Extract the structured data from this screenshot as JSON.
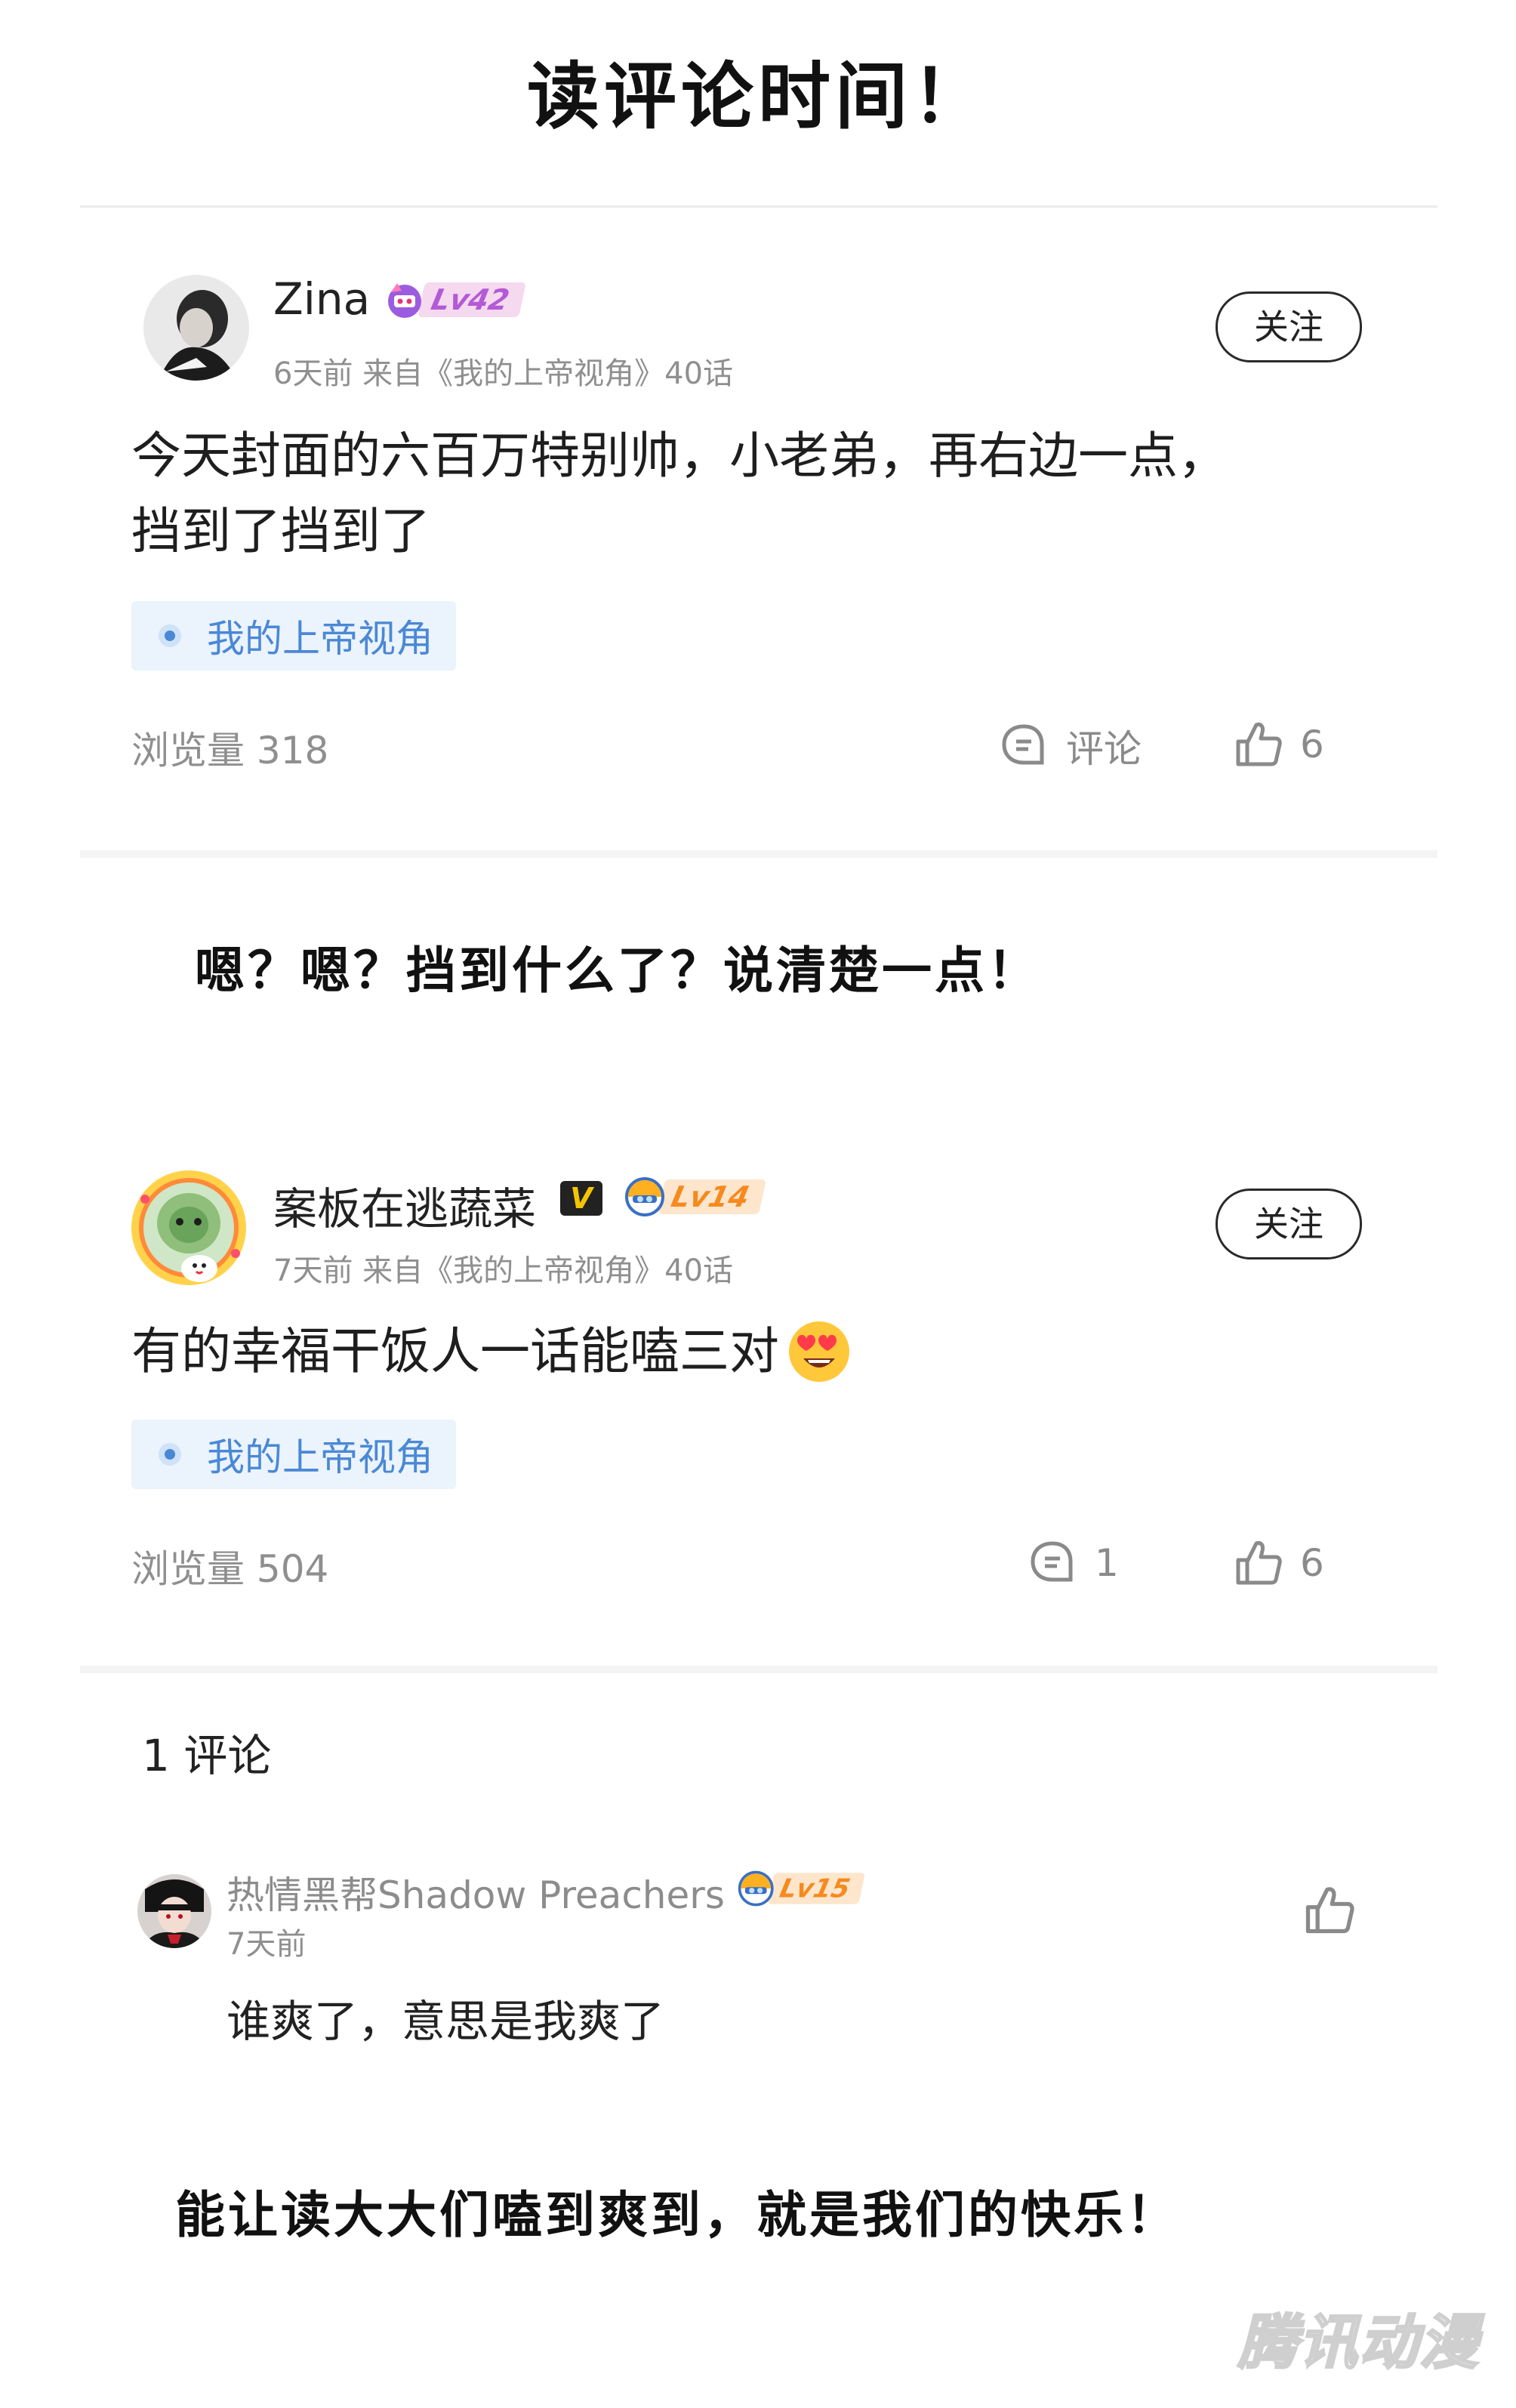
{
  "header": {
    "title": "读评论时间！"
  },
  "posts": [
    {
      "username": "Zina",
      "level": "Lv42",
      "meta": "6天前 来自《我的上帝视角》40话",
      "follow_label": "关注",
      "text_lines": [
        "今天封面的六百万特别帅，小老弟，再右边一点，",
        "挡到了挡到了"
      ],
      "topic": "我的上帝视角",
      "views": "浏览量 318",
      "comment_label": "评论",
      "likes": "6"
    },
    {
      "username": "案板在逃蔬菜",
      "vip": "V",
      "level": "Lv14",
      "meta": "7天前 来自《我的上帝视角》40话",
      "follow_label": "关注",
      "text": "有的幸福干饭人一话能嗑三对",
      "topic": "我的上帝视角",
      "views": "浏览量 504",
      "comment_count": "1",
      "likes": "6"
    }
  ],
  "captions": {
    "first": "嗯？嗯？挡到什么了？说清楚一点！",
    "last": "能让读大大们嗑到爽到，就是我们的快乐！"
  },
  "comments_section": {
    "count_label": "1 评论",
    "reply": {
      "username": "热情黑帮Shadow Preachers",
      "level": "Lv15",
      "time": "7天前",
      "text": "谁爽了，意思是我爽了"
    }
  },
  "watermark": "腾讯动漫",
  "colors": {
    "topic_blue": "#4a88d6",
    "topic_bg": "#ebf3fc",
    "level_purple": "#b35ad6",
    "level_orange": "#f58a1f",
    "meta_grey": "#8f8f8f"
  }
}
